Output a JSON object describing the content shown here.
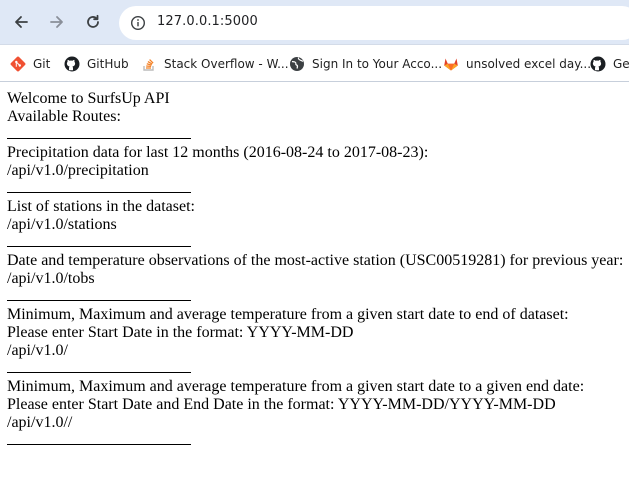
{
  "browser": {
    "url": "127.0.0.1:5000",
    "icons": {
      "back": "back-arrow-icon",
      "forward": "forward-arrow-icon",
      "reload": "reload-icon",
      "site_info": "site-info-icon"
    },
    "bookmarks": [
      {
        "label": "Git",
        "icon": "git-icon"
      },
      {
        "label": "GitHub",
        "icon": "github-icon"
      },
      {
        "label": "Stack Overflow - W...",
        "icon": "stackoverflow-icon"
      },
      {
        "label": "Sign In to Your Acco...",
        "icon": "globe-icon"
      },
      {
        "label": "unsolved excel day...",
        "icon": "gitlab-icon"
      },
      {
        "label": "Ge",
        "icon": "github-icon"
      }
    ]
  },
  "page": {
    "welcome": "Welcome to SurfsUp API",
    "routes_heading": "Available Routes:",
    "precipitation": {
      "desc": "Precipitation data for last 12 months (2016-08-24 to 2017-08-23):",
      "route": "/api/v1.0/precipitation"
    },
    "stations": {
      "desc": "List of stations in the dataset:",
      "route": "/api/v1.0/stations"
    },
    "tobs": {
      "desc": "Date and temperature observations of the most-active station (USC00519281) for previous year:",
      "route": "/api/v1.0/tobs"
    },
    "start": {
      "desc": "Minimum, Maximum and average temperature from a given start date to end of dataset:",
      "format": "Please enter Start Date in the format: YYYY-MM-DD",
      "route": "/api/v1.0/"
    },
    "start_end": {
      "desc": "Minimum, Maximum and average temperature from a given start date to a given end date:",
      "format": "Please enter Start Date and End Date in the format: YYYY-MM-DD/YYYY-MM-DD",
      "route": "/api/v1.0//"
    }
  }
}
